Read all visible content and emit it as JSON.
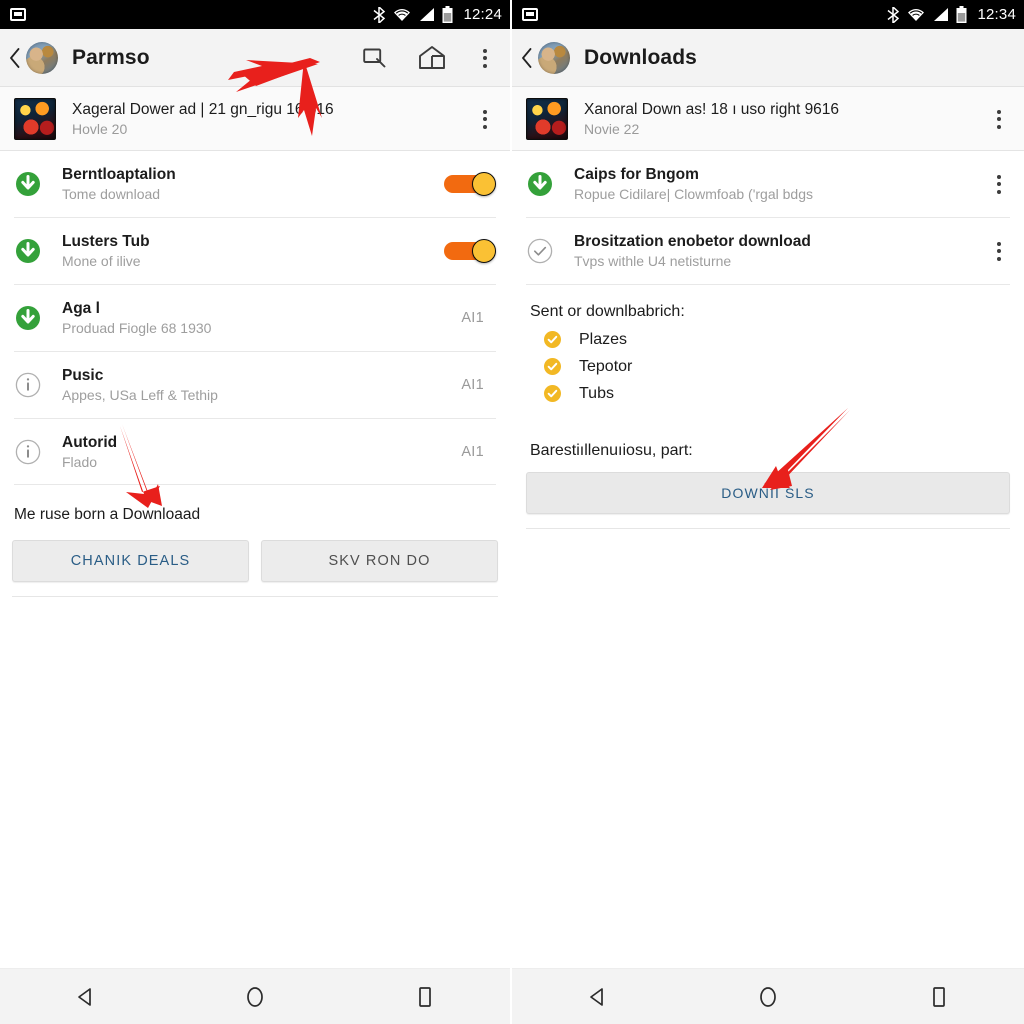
{
  "left_screen": {
    "status_bar": {
      "time": "12:24",
      "icons": [
        "sim-card-icon",
        "bluetooth-icon",
        "wifi-icon",
        "signal-icon",
        "battery-icon"
      ]
    },
    "app_bar": {
      "title": "Parmso",
      "back_icon": "back-chevron-icon",
      "avatar_icon": "avatar",
      "actions": [
        "search-icon",
        "cast-box-icon",
        "overflow-menu-icon"
      ]
    },
    "header_item": {
      "title": "Xageral Dower ad | 21 gn_rigu 16 616",
      "subtitle": "Hovle 20",
      "thumbnail": "movie-thumbnail",
      "overflow": "overflow-menu-icon"
    },
    "rows": [
      {
        "icon": "download-circle-icon",
        "title": "Berntloaptalion",
        "subtitle": "Tome download",
        "trailing_type": "toggle",
        "toggle_on": true,
        "trailing_text": ""
      },
      {
        "icon": "download-circle-icon",
        "title": "Lusters Tub",
        "subtitle": "Mone of ilive",
        "trailing_type": "toggle",
        "toggle_on": true,
        "trailing_text": ""
      },
      {
        "icon": "download-circle-icon",
        "title": "Aga l",
        "subtitle": "Produad Fiogle 68 1930",
        "trailing_type": "text",
        "toggle_on": false,
        "trailing_text": "AI1"
      },
      {
        "icon": "info-circle-icon",
        "title": "Pusic",
        "subtitle": "Appes, USa Leff & Tethip",
        "trailing_type": "text",
        "toggle_on": false,
        "trailing_text": "AI1"
      },
      {
        "icon": "info-circle-icon",
        "title": "Autorid",
        "subtitle": "Flado",
        "trailing_type": "text",
        "toggle_on": false,
        "trailing_text": "AI1"
      }
    ],
    "note": "Me ruse born a Downloaad",
    "buttons": {
      "primary": "CHANIK DEALS",
      "secondary": "SKV RON DO"
    },
    "nav_bar": [
      "back-triangle-icon",
      "home-circle-icon",
      "recents-square-icon"
    ]
  },
  "right_screen": {
    "status_bar": {
      "time": "12:34",
      "icons": [
        "sim-card-icon",
        "bluetooth-icon",
        "wifi-icon",
        "signal-icon",
        "battery-icon"
      ]
    },
    "app_bar": {
      "title": "Downloads",
      "back_icon": "back-chevron-icon",
      "avatar_icon": "avatar",
      "actions": []
    },
    "header_item": {
      "title": "Xanoral Down as! 18 ı uso right 9616",
      "subtitle": "Novie 22",
      "thumbnail": "movie-thumbnail",
      "overflow": "overflow-menu-icon"
    },
    "rows": [
      {
        "icon": "download-circle-icon",
        "title": "Caips for Bngom",
        "subtitle": "Ropue Cidilare| Clowmfoab ('rgal bdgs",
        "trailing_type": "overflow"
      },
      {
        "icon": "check-circle-outline-icon",
        "title": "Brositzation enobetor download",
        "subtitle": "Tvps withle U4 netisturne",
        "trailing_type": "overflow"
      }
    ],
    "checklist": {
      "title": "Sent or downlbabrich:",
      "items": [
        "Plazes",
        "Tepotor",
        "Tubs"
      ],
      "bullet_icon": "check-circle-filled-icon"
    },
    "note": "Barestiıllenuıiosu, part:",
    "download_button": "DOWNII SLS",
    "nav_bar": [
      "back-triangle-icon",
      "home-circle-icon",
      "recents-square-icon"
    ]
  },
  "colors": {
    "status_bar_bg": "#000000",
    "app_bar_bg": "#f3f3f3",
    "download_green": "#34a13a",
    "toggle_track": "#f26a10",
    "toggle_thumb": "#fac134",
    "check_yellow": "#f2b824",
    "link_blue": "#2a5d86",
    "arrow_red": "#e8201c"
  }
}
